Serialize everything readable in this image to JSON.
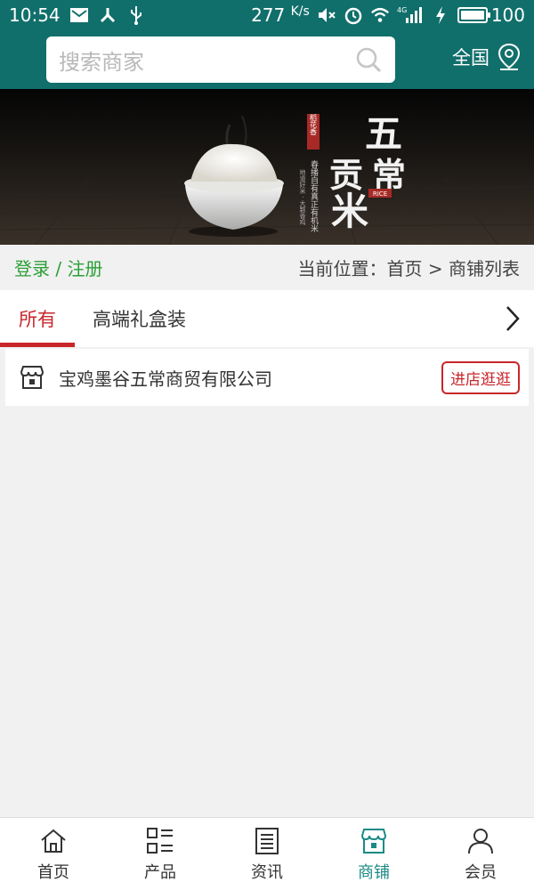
{
  "status_bar": {
    "time": "10:54",
    "speed": "277",
    "speed_unit": "K/s",
    "battery": "100",
    "battery_level": 1.0,
    "network": "4G",
    "icons": [
      "message-icon",
      "usb-debug-icon",
      "usb-icon",
      "mute-icon",
      "alarm-icon",
      "wifi-icon",
      "signal-icon",
      "charging-icon",
      "battery-icon"
    ]
  },
  "header": {
    "search_placeholder": "搜索商家",
    "region_label": "全国",
    "brand_color": "#116f6b"
  },
  "banner": {
    "title_lines": [
      "五",
      "常",
      "贡",
      "米"
    ],
    "badge": "稻花香",
    "tag": "RICE",
    "slogan": "春播自有真正有机米",
    "sub_slogan": "地道好米 · 大颗香鸡"
  },
  "breadcrumb": {
    "login": "登录",
    "separator": "/",
    "register": "注册",
    "location_label": "当前位置：",
    "home": "首页",
    "arrow": ">",
    "current": "商铺列表"
  },
  "tabs": [
    {
      "label": "所有",
      "active": true
    },
    {
      "label": "高端礼盒装",
      "active": false
    }
  ],
  "shops": [
    {
      "name": "宝鸡墨谷五常商贸有限公司",
      "button": "进店逛逛"
    }
  ],
  "bottom_nav": [
    {
      "label": "首页",
      "icon": "home-icon",
      "active": false
    },
    {
      "label": "产品",
      "icon": "grid-list-icon",
      "active": false
    },
    {
      "label": "资讯",
      "icon": "news-icon",
      "active": false
    },
    {
      "label": "商铺",
      "icon": "store-icon",
      "active": true
    },
    {
      "label": "会员",
      "icon": "user-icon",
      "active": false
    }
  ],
  "colors": {
    "accent_red": "#c8262a",
    "login_green": "#2aa036",
    "active_teal": "#1a8a85"
  }
}
